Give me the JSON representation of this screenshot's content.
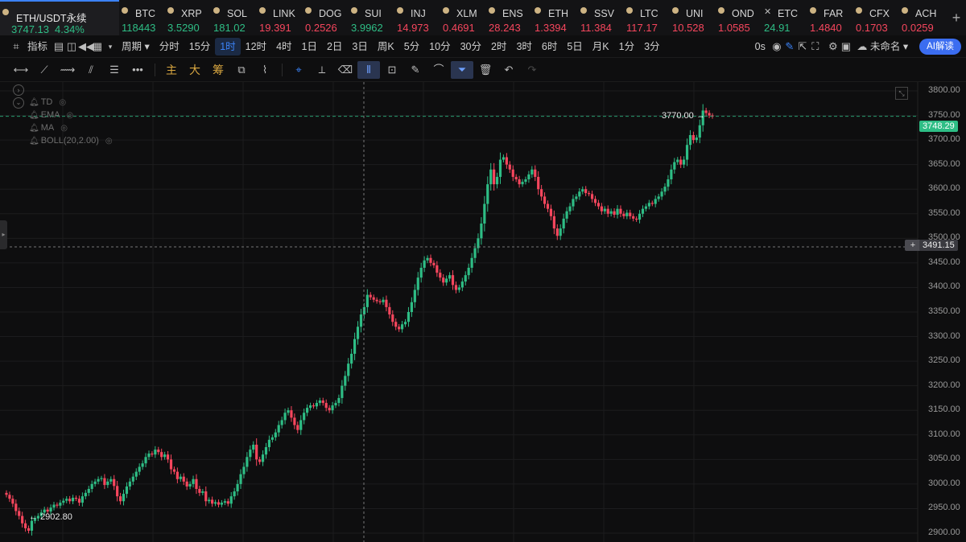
{
  "ticker": {
    "active": {
      "symbol": "ETH/USDT永续",
      "price": "3747.13",
      "change": "4.34%"
    },
    "items": [
      {
        "sym": "BTC",
        "price": "118443",
        "dir": "up"
      },
      {
        "sym": "XRP",
        "price": "3.5290",
        "dir": "up"
      },
      {
        "sym": "SOL",
        "price": "181.02",
        "dir": "up"
      },
      {
        "sym": "LINK",
        "price": "19.391",
        "dir": "down"
      },
      {
        "sym": "DOG",
        "price": "0.2526",
        "dir": "down"
      },
      {
        "sym": "SUI",
        "price": "3.9962",
        "dir": "up"
      },
      {
        "sym": "INJ",
        "price": "14.973",
        "dir": "down"
      },
      {
        "sym": "XLM",
        "price": "0.4691",
        "dir": "down"
      },
      {
        "sym": "ENS",
        "price": "28.243",
        "dir": "down"
      },
      {
        "sym": "ETH",
        "price": "1.3394",
        "dir": "down"
      },
      {
        "sym": "SSV",
        "price": "11.384",
        "dir": "down"
      },
      {
        "sym": "LTC",
        "price": "117.17",
        "dir": "down"
      },
      {
        "sym": "UNI",
        "price": "10.528",
        "dir": "down"
      },
      {
        "sym": "OND",
        "price": "1.0585",
        "dir": "down"
      },
      {
        "sym": "ETC",
        "price": "24.91",
        "dir": "up"
      },
      {
        "sym": "FAR",
        "price": "1.4840",
        "dir": "down"
      },
      {
        "sym": "CFX",
        "price": "0.1703",
        "dir": "down"
      },
      {
        "sym": "ACH",
        "price": "0.0259",
        "dir": "down"
      }
    ],
    "add": "+"
  },
  "toolbar": {
    "indicators": "指标",
    "period": "周期",
    "intervals": [
      "分时",
      "15分",
      "1时",
      "12时",
      "4时",
      "1日",
      "2日",
      "3日",
      "周K",
      "5分",
      "10分",
      "30分",
      "2时",
      "3时",
      "6时",
      "5日",
      "月K",
      "1分",
      "3分"
    ],
    "selected_interval": "1时",
    "countdown": "0s",
    "layout_name": "未命名",
    "ai": "AI解读"
  },
  "drawbar": {
    "main": "主",
    "big": "大",
    "chip": "筹"
  },
  "indicators": [
    "TD",
    "EMA",
    "MA",
    "BOLL(20,2.00)"
  ],
  "labels": {
    "last_price": "3748.29",
    "cursor_price": "3491.15",
    "high": "3770.00 →",
    "low": "← 2902.80"
  },
  "colors": {
    "up": "#2ebd85",
    "down": "#f6465d",
    "accent": "#3b82f6",
    "bg": "#0e0e0f"
  },
  "chart_data": {
    "type": "candlestick",
    "y_ticks": [
      3800,
      3750,
      3700,
      3650,
      3600,
      3550,
      3500,
      3450,
      3400,
      3350,
      3300,
      3250,
      3200,
      3150,
      3100,
      3050,
      3000,
      2950,
      2900
    ],
    "ylim": [
      2882,
      3818
    ],
    "high": 3770.0,
    "low": 2902.8,
    "last": 3748.29,
    "closes": [
      2978,
      2970,
      2960,
      2945,
      2935,
      2920,
      2910,
      2905,
      2925,
      2930,
      2935,
      2942,
      2948,
      2944,
      2952,
      2958,
      2956,
      2962,
      2966,
      2970,
      2965,
      2972,
      2970,
      2962,
      2975,
      2982,
      2990,
      3000,
      3005,
      3010,
      3012,
      2998,
      3005,
      3010,
      2996,
      2975,
      2965,
      2980,
      2995,
      3005,
      3015,
      3025,
      3035,
      3042,
      3055,
      3062,
      3060,
      3070,
      3065,
      3055,
      3060,
      3050,
      3030,
      3025,
      3010,
      3015,
      3005,
      2995,
      3000,
      3010,
      2990,
      2982,
      2985,
      2965,
      2968,
      2960,
      2963,
      2958,
      2962,
      2965,
      2960,
      2975,
      2985,
      3000,
      3020,
      3035,
      3055,
      3070,
      3080,
      3050,
      3045,
      3060,
      3075,
      3090,
      3095,
      3105,
      3120,
      3130,
      3145,
      3150,
      3135,
      3120,
      3110,
      3130,
      3145,
      3155,
      3160,
      3158,
      3165,
      3170,
      3165,
      3155,
      3150,
      3160,
      3165,
      3175,
      3200,
      3220,
      3245,
      3265,
      3295,
      3320,
      3345,
      3360,
      3385,
      3380,
      3375,
      3372,
      3370,
      3375,
      3360,
      3345,
      3330,
      3320,
      3315,
      3325,
      3330,
      3350,
      3370,
      3395,
      3420,
      3440,
      3455,
      3460,
      3450,
      3445,
      3430,
      3420,
      3410,
      3418,
      3425,
      3405,
      3395,
      3400,
      3412,
      3425,
      3440,
      3460,
      3480,
      3500,
      3530,
      3570,
      3610,
      3640,
      3610,
      3625,
      3660,
      3665,
      3650,
      3640,
      3625,
      3620,
      3610,
      3615,
      3620,
      3630,
      3640,
      3625,
      3600,
      3585,
      3570,
      3560,
      3545,
      3520,
      3505,
      3520,
      3540,
      3555,
      3565,
      3580,
      3585,
      3595,
      3600,
      3592,
      3590,
      3580,
      3572,
      3565,
      3555,
      3560,
      3550,
      3555,
      3548,
      3560,
      3550,
      3545,
      3552,
      3545,
      3540,
      3538,
      3550,
      3560,
      3565,
      3572,
      3570,
      3580,
      3585,
      3595,
      3605,
      3620,
      3640,
      3655,
      3660,
      3650,
      3660,
      3690,
      3710,
      3700,
      3705,
      3730,
      3760,
      3755,
      3750,
      3748
    ]
  }
}
